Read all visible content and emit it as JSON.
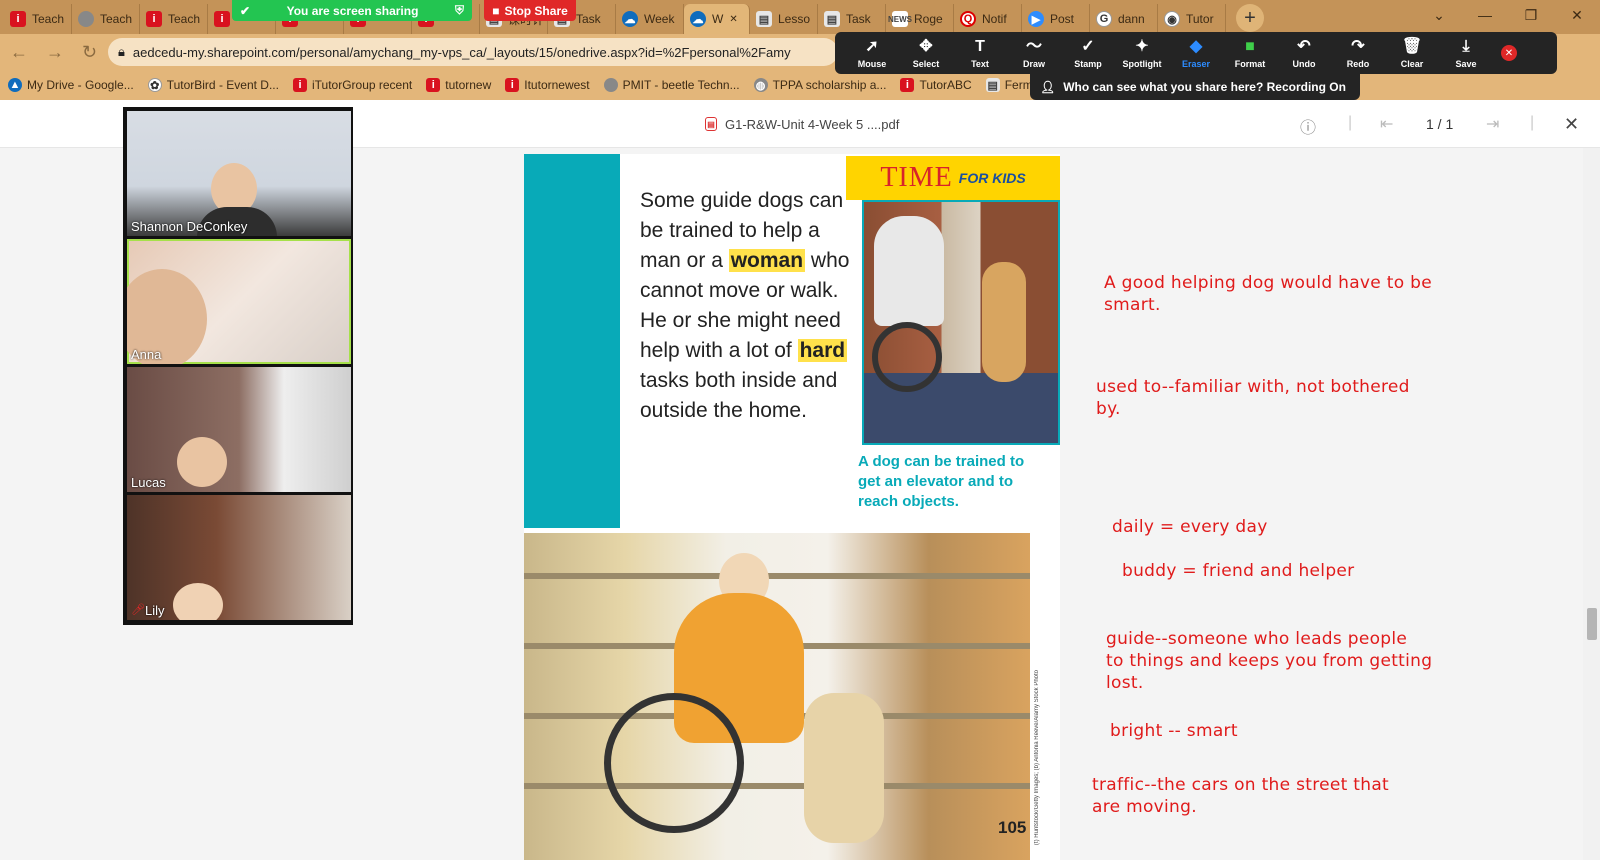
{
  "browser": {
    "tabs": [
      {
        "label": "Teach",
        "icon": "itutor-icon"
      },
      {
        "label": "Teach",
        "icon": "globe-icon"
      },
      {
        "label": "Teach",
        "icon": "itutor-icon"
      },
      {
        "label": "",
        "icon": "itutor-icon"
      },
      {
        "label": "",
        "icon": "itutor-icon"
      },
      {
        "label": "",
        "icon": "itutor-icon"
      },
      {
        "label": "",
        "icon": "itutor-icon"
      },
      {
        "label": "课时计",
        "icon": "doc-icon"
      },
      {
        "label": "Task",
        "icon": "doc-icon"
      },
      {
        "label": "Week",
        "icon": "onedrive-icon"
      },
      {
        "label": "W",
        "icon": "onedrive-icon",
        "active": true
      },
      {
        "label": "Lesso",
        "icon": "doc-icon"
      },
      {
        "label": "Task",
        "icon": "doc-icon"
      },
      {
        "label": "Roge",
        "icon": "news-icon"
      },
      {
        "label": "Notif",
        "icon": "quora-icon"
      },
      {
        "label": "Post",
        "icon": "zoom-icon"
      },
      {
        "label": "dann",
        "icon": "google-icon"
      },
      {
        "label": "Tutor",
        "icon": "chrome-icon"
      }
    ],
    "url": "aedcedu-my.sharepoint.com/personal/amychang_my-vps_ca/_layouts/15/onedrive.aspx?id=%2Fpersonal%2Famy",
    "bookmarks": [
      {
        "label": "My Drive - Google...",
        "icon": "drive-icon"
      },
      {
        "label": "TutorBird - Event D...",
        "icon": "tutorbird-icon"
      },
      {
        "label": "iTutorGroup recent",
        "icon": "itutor-icon"
      },
      {
        "label": "tutornew",
        "icon": "itutor-icon"
      },
      {
        "label": "Itutornewest",
        "icon": "itutor-icon"
      },
      {
        "label": "PMIT - beetle Techn...",
        "icon": "globe-icon"
      },
      {
        "label": "TPPA scholarship a...",
        "icon": "tppa-icon"
      },
      {
        "label": "TutorABC",
        "icon": "itutor-icon"
      },
      {
        "label": "Fermi Questions",
        "icon": "doc-icon"
      }
    ]
  },
  "zoom": {
    "sharing_text": "You are screen sharing",
    "stop_share": "Stop Share",
    "tools": [
      {
        "label": "Mouse",
        "icon": "cursor-icon",
        "glyph": "➚"
      },
      {
        "label": "Select",
        "icon": "move-icon",
        "glyph": "✥"
      },
      {
        "label": "Text",
        "icon": "text-icon",
        "glyph": "T"
      },
      {
        "label": "Draw",
        "icon": "squiggle-icon",
        "glyph": "〜"
      },
      {
        "label": "Stamp",
        "icon": "check-icon",
        "glyph": "✓"
      },
      {
        "label": "Spotlight",
        "icon": "wand-icon",
        "glyph": "✦"
      },
      {
        "label": "Eraser",
        "icon": "eraser-icon",
        "glyph": "◆",
        "active": true
      },
      {
        "label": "Format",
        "icon": "color-swatch-icon",
        "glyph": "■"
      },
      {
        "label": "Undo",
        "icon": "undo-icon",
        "glyph": "↶"
      },
      {
        "label": "Redo",
        "icon": "redo-icon",
        "glyph": "↷"
      },
      {
        "label": "Clear",
        "icon": "trash-icon",
        "glyph": "🗑"
      },
      {
        "label": "Save",
        "icon": "save-icon",
        "glyph": "⤓"
      }
    ],
    "recording_text": "Who can see what you share here? Recording On",
    "participants": [
      {
        "name": "Shannon DeConkey"
      },
      {
        "name": "Anna"
      },
      {
        "name": "Lucas"
      },
      {
        "name": "Lily"
      }
    ]
  },
  "viewer": {
    "doc_title": "G1-R&W-Unit 4-Week 5 ....pdf",
    "page_indicator": "1 / 1"
  },
  "document": {
    "passage_parts": [
      "Some guide dogs can be trained to help a man or a ",
      "woman",
      " who cannot move or walk. He or she might need help with a lot of ",
      "hard",
      " tasks both inside and outside the home."
    ],
    "brand_time": "TIME",
    "brand_kids": "FOR KIDS",
    "caption": "A dog can be trained to get an elevator and to reach objects.",
    "page_number": "105",
    "photo_credit": "(t) Huntstock/Getty Images; (b) Antonia Reeve/Alamy Stock Photo"
  },
  "notes": [
    "A good helping dog would have to be\nsmart.",
    "used to--familiar with, not bothered\nby.",
    "daily = every day",
    "buddy = friend and helper",
    "guide--someone who leads people\nto things and keeps you from getting\nlost.",
    "bright -- smart",
    "traffic--the cars on the street that\nare moving."
  ]
}
